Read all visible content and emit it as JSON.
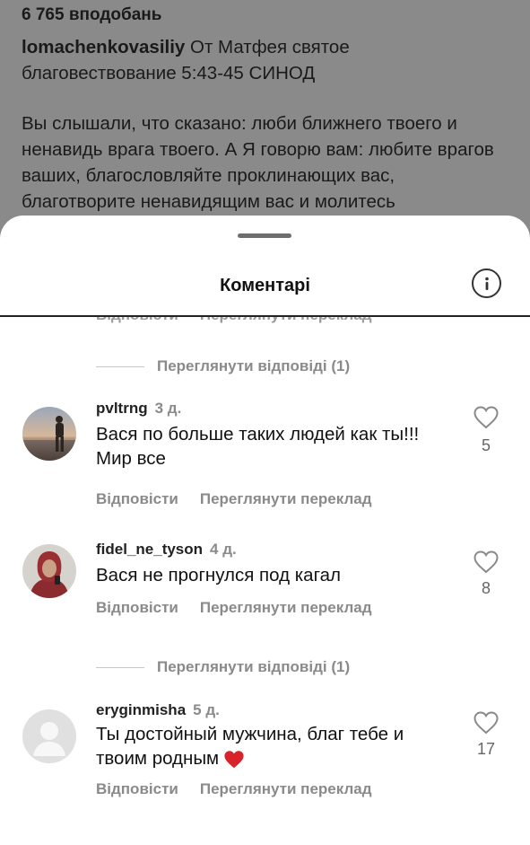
{
  "post": {
    "likes": "6 765 вподобань",
    "author": "lomachenkovasiliy",
    "caption_line1": "От Матфея святое",
    "caption_line2": "благовествование 5:43-45 СИНОД",
    "paragraph": "Вы слышали, что сказано: люби ближнего твоего и ненавидь врага твоего. А Я говорю вам: любите врагов ваших, благословляйте проклинающих вас, благотворите ненавидящим вас и молитесь"
  },
  "sheet": {
    "title": "Коментарі",
    "info_icon": "info-icon"
  },
  "actions": {
    "reply": "Відповісти",
    "translate": "Переглянути переклад"
  },
  "view_replies_1": "Переглянути відповіді (1)",
  "view_replies_2": "Переглянути відповіді (1)",
  "comments": [
    {
      "username": "pvltrng",
      "time": "3 д.",
      "text": "Вася по больше таких людей как ты!!! Мир все",
      "likes": "5"
    },
    {
      "username": "fidel_ne_tyson",
      "time": "4 д.",
      "text": "Вася не прогнулся под кагал",
      "likes": "8"
    },
    {
      "username": "eryginmisha",
      "time": "5 д.",
      "text": "Ты достойный мужчина, благ тебе и твоим родным",
      "likes": "17"
    }
  ],
  "colors": {
    "overlay": "#8a8a8a",
    "heart_red": "#d8232a",
    "secondary_text": "#8a8a8a"
  }
}
